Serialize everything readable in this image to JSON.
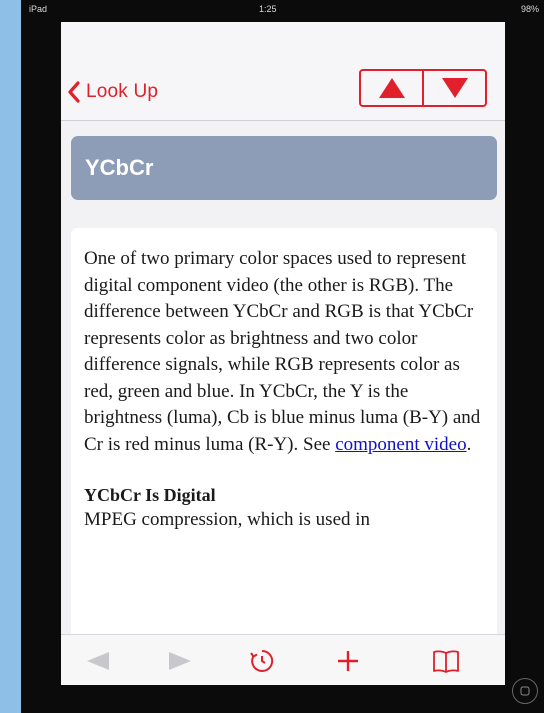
{
  "status_bar": {
    "carrier": "iPad",
    "time": "1:25",
    "battery": "98%"
  },
  "nav": {
    "back_label": "Look Up"
  },
  "entry": {
    "title": "YCbCr",
    "body_text": "One of two primary color spaces used to represent digital component video (the other is RGB). The difference between YCbCr and RGB is that YCbCr represents color as brightness and two color difference signals, while RGB represents color as red, green and blue. In YCbCr, the Y is the brightness (luma), Cb is blue minus luma (B-Y) and Cr is red minus luma (R-Y). See ",
    "link_text": "component video",
    "body_end": ".",
    "subheading": "YCbCr Is Digital",
    "cut_text": "MPEG compression, which is used in"
  },
  "toolbar": {
    "icons": [
      "back-arrow-icon",
      "forward-arrow-icon",
      "history-clock-icon",
      "add-plus-icon",
      "bookmarks-book-icon"
    ]
  },
  "colors": {
    "accent": "#e0202a",
    "title_banner": "#8d9db7",
    "background": "#8ec0e7",
    "link": "#1010cc",
    "disabled_icon": "#c8c8cc"
  }
}
